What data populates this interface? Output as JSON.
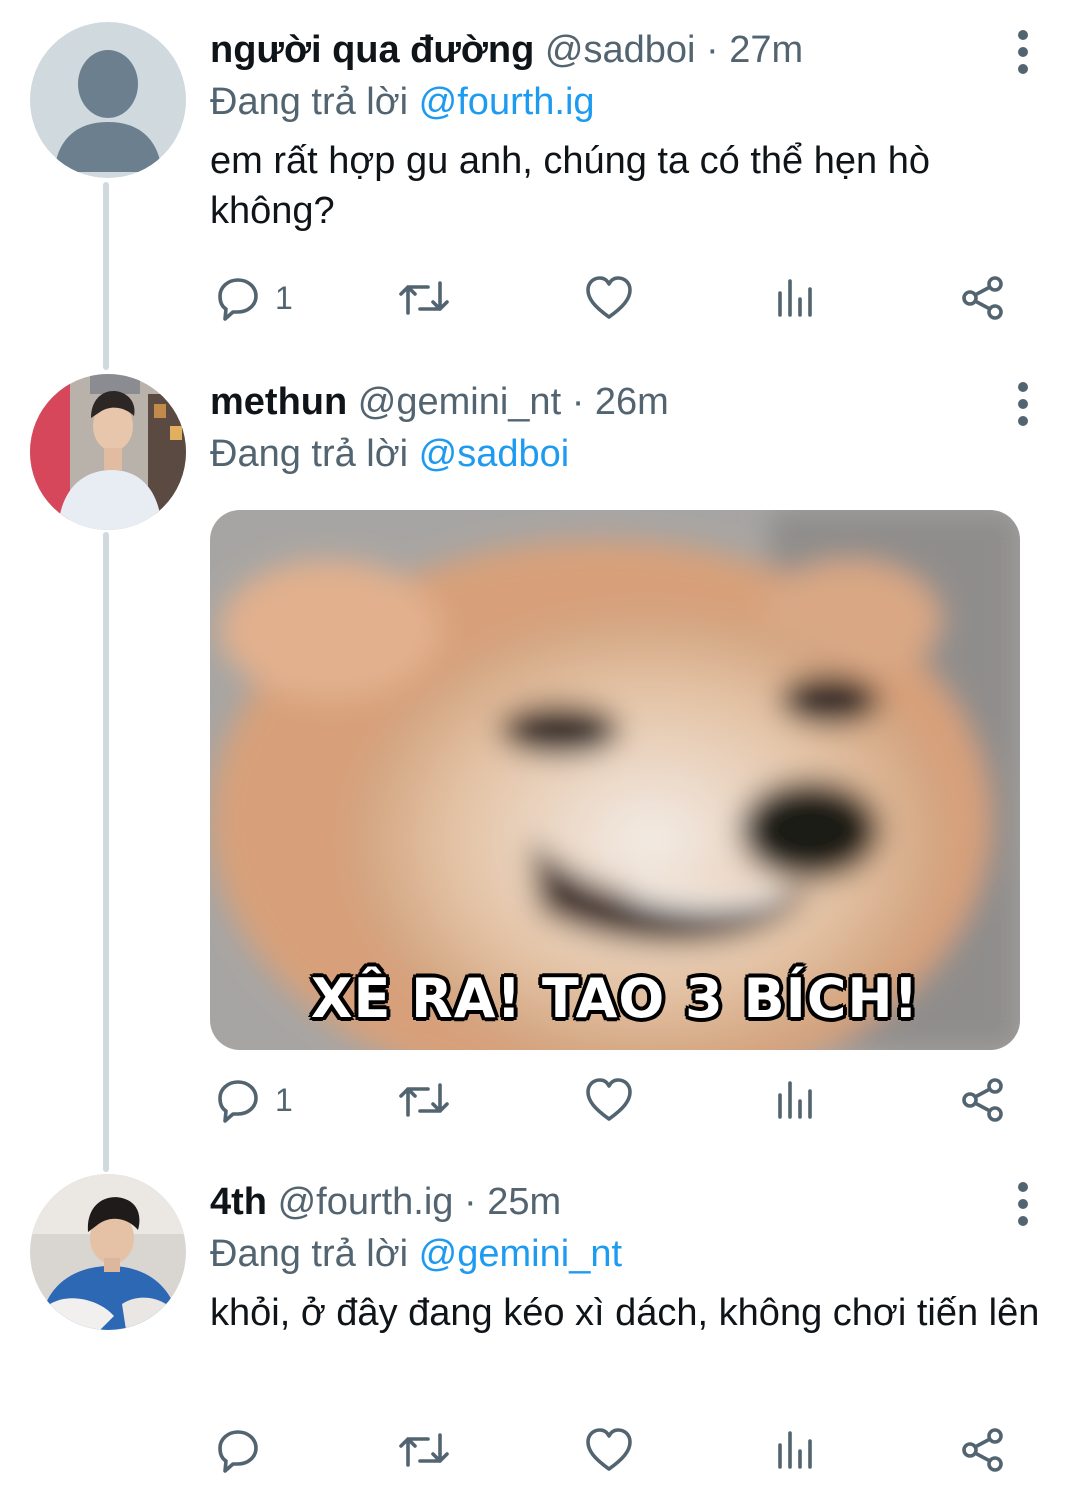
{
  "tweets": [
    {
      "display_name": "người qua đường",
      "handle": "@sadboi",
      "time": "27m",
      "replying_prefix": "Đang trả lời",
      "replying_to": "@fourth.ig",
      "text": "em rất hợp gu anh, chúng ta có thể hẹn hò không?",
      "reply_count": "1",
      "avatar_icon": "default-person-icon"
    },
    {
      "display_name": "methun",
      "handle": "@gemini_nt",
      "time": "26m",
      "replying_prefix": "Đang trả lời",
      "replying_to": "@sadboi",
      "media_caption": "XÊ RA! TAO 3 BÍCH!",
      "reply_count": "1"
    },
    {
      "display_name": "4th",
      "handle": "@fourth.ig",
      "time": "25m",
      "replying_prefix": "Đang trả lời",
      "replying_to": "@gemini_nt",
      "text": "khỏi, ở đây đang kéo xì dách, không chơi tiến lên",
      "reply_count": ""
    }
  ],
  "meta_separator": "·",
  "colors": {
    "text": "#0f1419",
    "muted": "#536471",
    "link": "#1d9bf0",
    "thread_line": "#cfd9de"
  }
}
